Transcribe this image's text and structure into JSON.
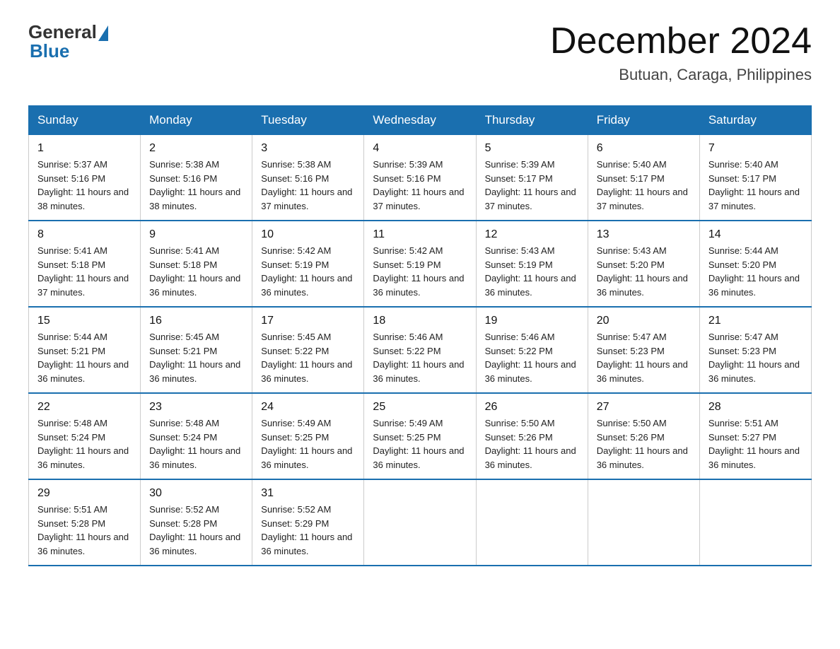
{
  "header": {
    "logo_general": "General",
    "logo_blue": "Blue",
    "month_title": "December 2024",
    "location": "Butuan, Caraga, Philippines"
  },
  "calendar": {
    "days_of_week": [
      "Sunday",
      "Monday",
      "Tuesday",
      "Wednesday",
      "Thursday",
      "Friday",
      "Saturday"
    ],
    "weeks": [
      [
        {
          "day": "1",
          "sunrise": "5:37 AM",
          "sunset": "5:16 PM",
          "daylight": "11 hours and 38 minutes."
        },
        {
          "day": "2",
          "sunrise": "5:38 AM",
          "sunset": "5:16 PM",
          "daylight": "11 hours and 38 minutes."
        },
        {
          "day": "3",
          "sunrise": "5:38 AM",
          "sunset": "5:16 PM",
          "daylight": "11 hours and 37 minutes."
        },
        {
          "day": "4",
          "sunrise": "5:39 AM",
          "sunset": "5:16 PM",
          "daylight": "11 hours and 37 minutes."
        },
        {
          "day": "5",
          "sunrise": "5:39 AM",
          "sunset": "5:17 PM",
          "daylight": "11 hours and 37 minutes."
        },
        {
          "day": "6",
          "sunrise": "5:40 AM",
          "sunset": "5:17 PM",
          "daylight": "11 hours and 37 minutes."
        },
        {
          "day": "7",
          "sunrise": "5:40 AM",
          "sunset": "5:17 PM",
          "daylight": "11 hours and 37 minutes."
        }
      ],
      [
        {
          "day": "8",
          "sunrise": "5:41 AM",
          "sunset": "5:18 PM",
          "daylight": "11 hours and 37 minutes."
        },
        {
          "day": "9",
          "sunrise": "5:41 AM",
          "sunset": "5:18 PM",
          "daylight": "11 hours and 36 minutes."
        },
        {
          "day": "10",
          "sunrise": "5:42 AM",
          "sunset": "5:19 PM",
          "daylight": "11 hours and 36 minutes."
        },
        {
          "day": "11",
          "sunrise": "5:42 AM",
          "sunset": "5:19 PM",
          "daylight": "11 hours and 36 minutes."
        },
        {
          "day": "12",
          "sunrise": "5:43 AM",
          "sunset": "5:19 PM",
          "daylight": "11 hours and 36 minutes."
        },
        {
          "day": "13",
          "sunrise": "5:43 AM",
          "sunset": "5:20 PM",
          "daylight": "11 hours and 36 minutes."
        },
        {
          "day": "14",
          "sunrise": "5:44 AM",
          "sunset": "5:20 PM",
          "daylight": "11 hours and 36 minutes."
        }
      ],
      [
        {
          "day": "15",
          "sunrise": "5:44 AM",
          "sunset": "5:21 PM",
          "daylight": "11 hours and 36 minutes."
        },
        {
          "day": "16",
          "sunrise": "5:45 AM",
          "sunset": "5:21 PM",
          "daylight": "11 hours and 36 minutes."
        },
        {
          "day": "17",
          "sunrise": "5:45 AM",
          "sunset": "5:22 PM",
          "daylight": "11 hours and 36 minutes."
        },
        {
          "day": "18",
          "sunrise": "5:46 AM",
          "sunset": "5:22 PM",
          "daylight": "11 hours and 36 minutes."
        },
        {
          "day": "19",
          "sunrise": "5:46 AM",
          "sunset": "5:22 PM",
          "daylight": "11 hours and 36 minutes."
        },
        {
          "day": "20",
          "sunrise": "5:47 AM",
          "sunset": "5:23 PM",
          "daylight": "11 hours and 36 minutes."
        },
        {
          "day": "21",
          "sunrise": "5:47 AM",
          "sunset": "5:23 PM",
          "daylight": "11 hours and 36 minutes."
        }
      ],
      [
        {
          "day": "22",
          "sunrise": "5:48 AM",
          "sunset": "5:24 PM",
          "daylight": "11 hours and 36 minutes."
        },
        {
          "day": "23",
          "sunrise": "5:48 AM",
          "sunset": "5:24 PM",
          "daylight": "11 hours and 36 minutes."
        },
        {
          "day": "24",
          "sunrise": "5:49 AM",
          "sunset": "5:25 PM",
          "daylight": "11 hours and 36 minutes."
        },
        {
          "day": "25",
          "sunrise": "5:49 AM",
          "sunset": "5:25 PM",
          "daylight": "11 hours and 36 minutes."
        },
        {
          "day": "26",
          "sunrise": "5:50 AM",
          "sunset": "5:26 PM",
          "daylight": "11 hours and 36 minutes."
        },
        {
          "day": "27",
          "sunrise": "5:50 AM",
          "sunset": "5:26 PM",
          "daylight": "11 hours and 36 minutes."
        },
        {
          "day": "28",
          "sunrise": "5:51 AM",
          "sunset": "5:27 PM",
          "daylight": "11 hours and 36 minutes."
        }
      ],
      [
        {
          "day": "29",
          "sunrise": "5:51 AM",
          "sunset": "5:28 PM",
          "daylight": "11 hours and 36 minutes."
        },
        {
          "day": "30",
          "sunrise": "5:52 AM",
          "sunset": "5:28 PM",
          "daylight": "11 hours and 36 minutes."
        },
        {
          "day": "31",
          "sunrise": "5:52 AM",
          "sunset": "5:29 PM",
          "daylight": "11 hours and 36 minutes."
        },
        null,
        null,
        null,
        null
      ]
    ]
  }
}
